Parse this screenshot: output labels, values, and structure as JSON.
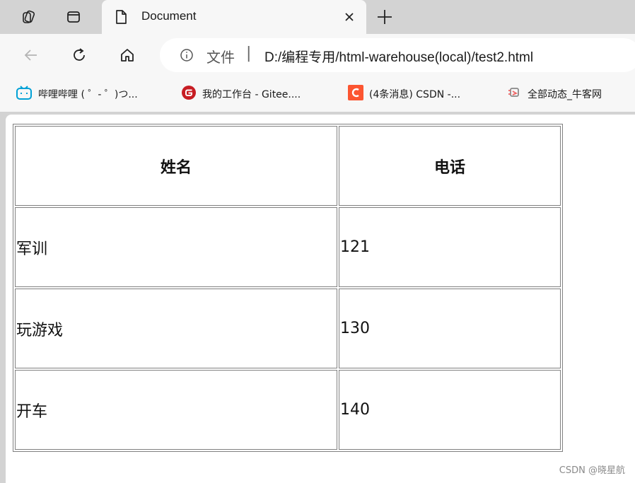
{
  "tab": {
    "title": "Document"
  },
  "address": {
    "scheme_label": "文件",
    "separator": "|",
    "url": "D:/编程专用/html-warehouse(local)/test2.html"
  },
  "bookmarks": [
    {
      "label": "哔哩哔哩 ( ゜- ゜)つ...",
      "icon": "bilibili-icon"
    },
    {
      "label": "我的工作台 - Gitee....",
      "icon": "gitee-icon"
    },
    {
      "label": "(4条消息) CSDN -...",
      "icon": "csdn-icon"
    },
    {
      "label": "全部动态_牛客网",
      "icon": "nowcoder-icon"
    }
  ],
  "table": {
    "headers": [
      "姓名",
      "电话"
    ],
    "rows": [
      [
        "军训",
        "121"
      ],
      [
        "玩游戏",
        "130"
      ],
      [
        "开车",
        "140"
      ]
    ]
  },
  "watermark": "CSDN @晓星航",
  "colors": {
    "chrome_bg": "#d3d3d3",
    "toolbar_bg": "#f7f7f7",
    "bilibili": "#00a1d6",
    "gitee": "#c71d23",
    "csdn": "#fc5531"
  }
}
